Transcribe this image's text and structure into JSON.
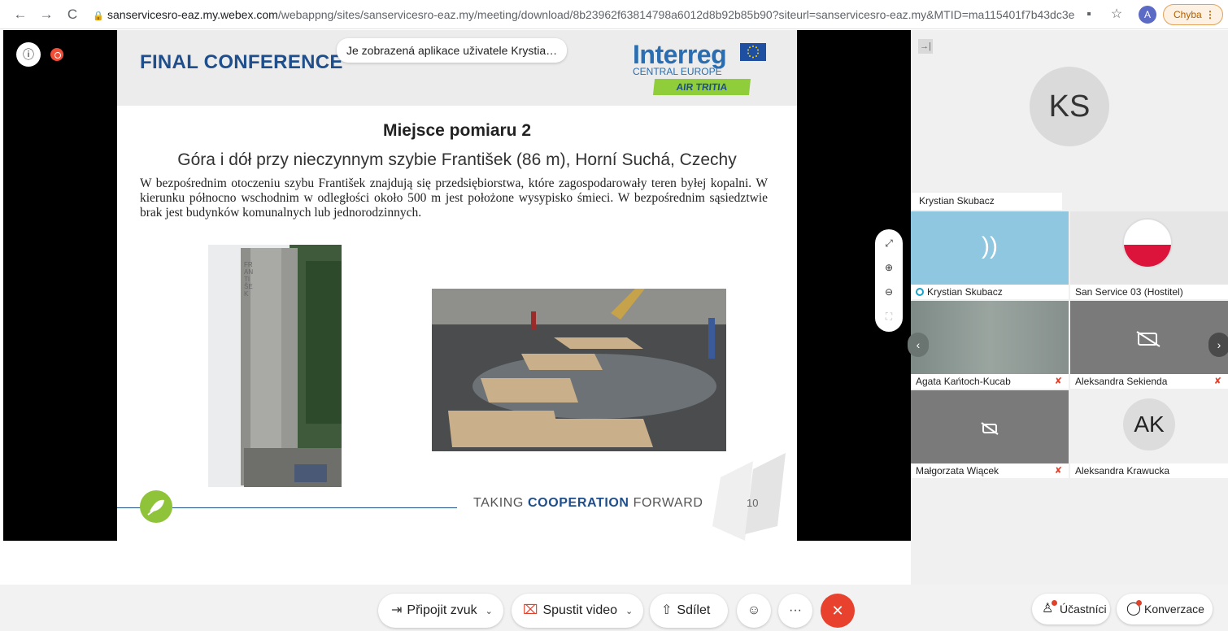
{
  "browser": {
    "url_host": "sanservicesro-eaz.my.webex.com",
    "url_path": "/webappng/sites/sanservicesro-eaz.my/meeting/download/8b23962f63814798a6012d8b92b85b90?siteurl=sanservicesro-eaz.my&MTID=ma115401f7b43dc3e...",
    "profile_initial": "A",
    "error_label": "Chyba"
  },
  "share_notice": "Je zobrazená aplikace uživatele Krystia…",
  "slide": {
    "header_title": "FINAL CONFERENCE",
    "logo_word": "Interreg",
    "logo_sub": "CENTRAL EUROPE",
    "logo_project": "AIR TRITIA",
    "title1": "Miejsce pomiaru 2",
    "title2": "Góra i dół przy nieczynnym szybie František (86 m), Horní Suchá, Czechy",
    "body": "W bezpośrednim otoczeniu szybu František znajdują się przedsiębiorstwa, które zagospodarowały teren byłej kopalni. W kierunku północno wschodnim w odległości około 500 m jest położone wysypisko śmieci. W bezpośrednim sąsiedztwie brak jest budynków komunalnych lub jednorodzinnych.",
    "tower_sign": "FRANTIŠEK",
    "footer_pre": "TAKING ",
    "footer_bold": "COOPERATION",
    "footer_post": " FORWARD",
    "page_number": "10"
  },
  "participants": {
    "main_initials": "KS",
    "main_name": "Krystian Skubacz",
    "tiles": [
      {
        "name": "Krystian Skubacz"
      },
      {
        "name": "San Service 03 (Hostitel)"
      },
      {
        "name": "Agata Kańtoch-Kucab"
      },
      {
        "name": "Aleksandra Sekienda"
      },
      {
        "name": "Małgorzata Wiącek"
      },
      {
        "name": "Aleksandra Krawucka",
        "initials": "AK"
      }
    ]
  },
  "controls": {
    "audio": "Připojit zvuk",
    "video": "Spustit video",
    "share": "Sdílet",
    "participants": "Účastníci",
    "chat": "Konverzace"
  },
  "colors": {
    "accent_blue": "#1f4e8c",
    "end_call": "#e8412e",
    "active_speaker_tile": "#8fc7e0",
    "leaf_green": "#8fc43a"
  }
}
